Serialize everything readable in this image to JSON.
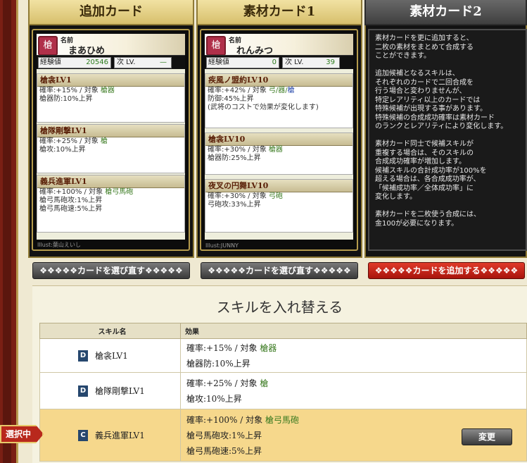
{
  "panels": {
    "add_title": "追加カード",
    "mat1_title": "素材カード1",
    "mat2_title": "素材カード2"
  },
  "card_add": {
    "badge": "槍",
    "name_label": "名前",
    "name": "まあひめ",
    "exp_label": "経験値",
    "exp": "20546",
    "next_label": "次 LV.",
    "next": "—",
    "illust": "Illust:葉山えいし",
    "skills": [
      {
        "title": "槍衾LV1",
        "line1": "確率:+15% / 対象",
        "target": "槍器",
        "line2": "槍器防:10%上昇",
        "line3": ""
      },
      {
        "title": "槍隊剛撃LV1",
        "line1": "確率:+25% / 対象",
        "target": "槍",
        "line2": "槍攻:10%上昇",
        "line3": ""
      },
      {
        "title": "義兵進軍LV1",
        "line1": "確率:+100% / 対象",
        "target": "槍弓馬砲",
        "line2": "槍弓馬砲攻:1%上昇",
        "line3": "槍弓馬砲速:5%上昇"
      }
    ]
  },
  "card_mat1": {
    "badge": "槍",
    "name_label": "名前",
    "name": "れんみつ",
    "exp_label": "経験値",
    "exp": "0",
    "next_label": "次 LV.",
    "next": "39",
    "illust": "Illust:JUNNY",
    "skills": [
      {
        "title": "疾風ノ盟約LV10",
        "line1": "確率:+42% / 対象",
        "target": "弓/器/",
        "target2": "槍",
        "line2": "防御:45%上昇",
        "line3": "(武将のコストで効果が変化します)"
      },
      {
        "title": "槍衾LV10",
        "line1": "確率:+30% / 対象",
        "target": "槍器",
        "target2": "",
        "line2": "槍器防:25%上昇",
        "line3": ""
      },
      {
        "title": "夜叉の円舞LV10",
        "line1": "確率:+30% / 対象",
        "target": "弓砲",
        "target2": "",
        "line2": "弓砲攻:33%上昇",
        "line3": ""
      }
    ]
  },
  "mat2_desc": "素材カードを更に追加すると、\n二枚の素材をまとめて合成する\nことができます。\n\n追加候補となるスキルは、\nそれぞれのカードで二回合成を\n行う場合と変わりませんが、\n特定レアリティ以上のカードでは\n特殊候補が出現する事があります。\n特殊候補の合成成功確率は素材カード\nのランクとレアリティにより変化します。\n\n素材カード同士で候補スキルが\n重複する場合は、そのスキルの\n合成成功確率が増加します。\n候補スキルの合計成功率が100%を\n超える場合は、各合成成功率が、\n「候補成功率／全体成功率」に\n変化します。\n\n素材カードを二枚使う合成には、\n金100が必要になります。",
  "buttons": {
    "reselect1": "❖❖❖❖❖カードを選び直す❖❖❖❖❖",
    "reselect2": "❖❖❖❖❖カードを選び直す❖❖❖❖❖",
    "add": "❖❖❖❖❖カードを追加する❖❖❖❖❖"
  },
  "swap": {
    "title": "スキルを入れ替える",
    "col_name": "スキル名",
    "col_effect": "効果",
    "rows": [
      {
        "icon": "D",
        "name": "槍衾LV1",
        "l1": "確率:+15% / 対象",
        "target": "槍器",
        "l2": "槍器防:10%上昇",
        "l3": ""
      },
      {
        "icon": "D",
        "name": "槍隊剛撃LV1",
        "l1": "確率:+25% / 対象",
        "target": "槍",
        "l2": "槍攻:10%上昇",
        "l3": ""
      },
      {
        "icon": "C",
        "name": "義兵進軍LV1",
        "l1": "確率:+100% / 対象",
        "target": "槍弓馬砲",
        "l2": "槍弓馬砲攻:1%上昇",
        "l3": "槍弓馬砲速:5%上昇"
      }
    ],
    "selected_label": "選択中",
    "change_label": "変更"
  }
}
